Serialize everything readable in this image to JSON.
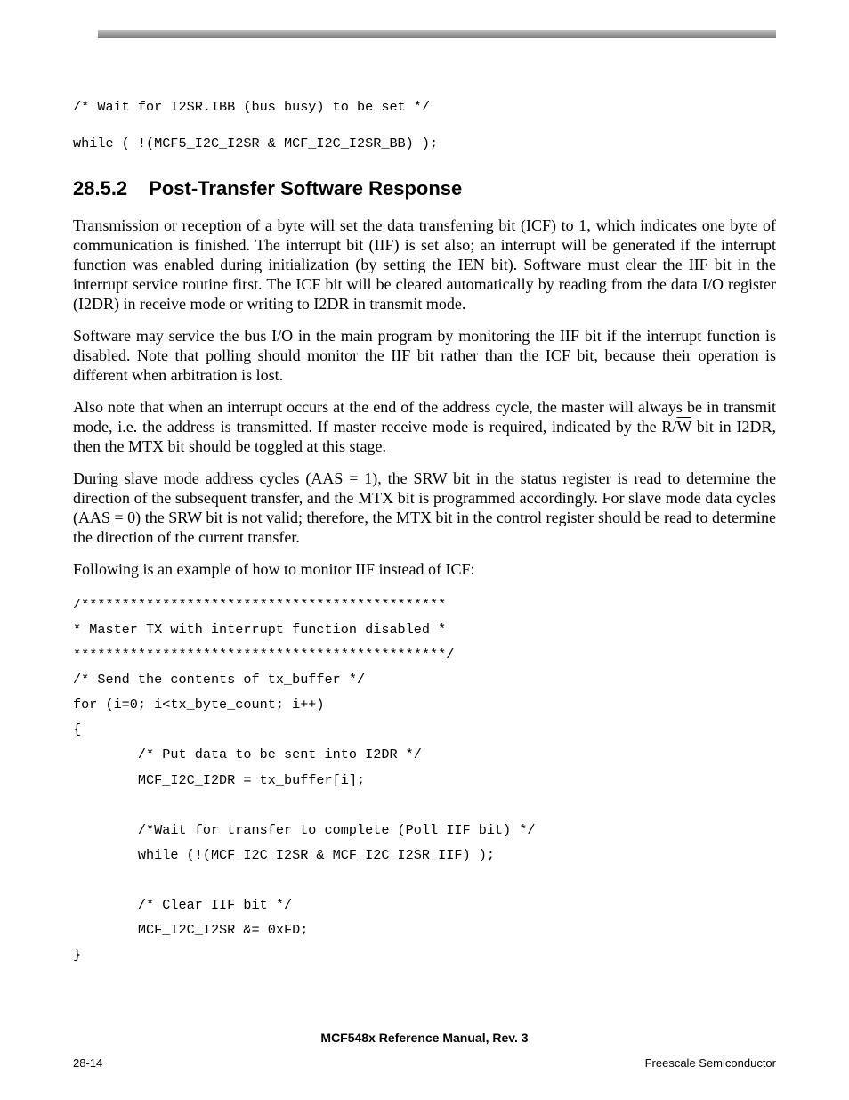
{
  "code_intro_1": "/* Wait for I2SR.IBB (bus busy) to be set */",
  "code_intro_2": "while ( !(MCF5_I2C_I2SR & MCF_I2C_I2SR_BB) );",
  "section": {
    "num": "28.5.2",
    "title": "Post-Transfer Software Response"
  },
  "p1": "Transmission or reception of a byte will set the data transferring bit (ICF) to 1, which indicates one byte of communication is finished. The interrupt bit (IIF) is set also; an interrupt will be generated if the interrupt function was enabled during initialization (by setting the IEN bit). Software must clear the IIF bit in the interrupt service routine first. The ICF bit will be cleared automatically by reading from the data I/O register (I2DR) in receive mode or writing to I2DR in transmit mode.",
  "p2": "Software may service the bus I/O in the main program by monitoring the IIF bit if the interrupt function is disabled. Note that polling should monitor the IIF bit rather than the ICF bit, because their operation is different when arbitration is lost.",
  "p3_a": "Also note that when an interrupt occurs at the end of the address cycle, the master will always be in transmit mode, i.e. the address is transmitted. If master receive mode is required, indicated by the R/",
  "p3_w": "W",
  "p3_b": " bit in I2DR, then the MTX bit should be toggled at this stage.",
  "p4": "During slave mode address cycles (AAS = 1), the SRW bit in the status register is read to determine the direction of the subsequent transfer, and the MTX bit is programmed accordingly. For slave mode data cycles (AAS = 0) the SRW bit is not valid; therefore, the MTX bit in the control register should be read to determine the direction of the current transfer.",
  "p5": "Following is an example of how to monitor IIF instead of ICF:",
  "code_main": "/*********************************************\n* Master TX with interrupt function disabled *\n**********************************************/\n/* Send the contents of tx_buffer */\nfor (i=0; i<tx_byte_count; i++)\n{\n        /* Put data to be sent into I2DR */\n        MCF_I2C_I2DR = tx_buffer[i];\n\n        /*Wait for transfer to complete (Poll IIF bit) */\n        while (!(MCF_I2C_I2SR & MCF_I2C_I2SR_IIF) );\n\n        /* Clear IIF bit */\n        MCF_I2C_I2SR &= 0xFD;\n}",
  "footer_title": "MCF548x Reference Manual, Rev. 3",
  "footer_left": "28-14",
  "footer_right": "Freescale Semiconductor"
}
